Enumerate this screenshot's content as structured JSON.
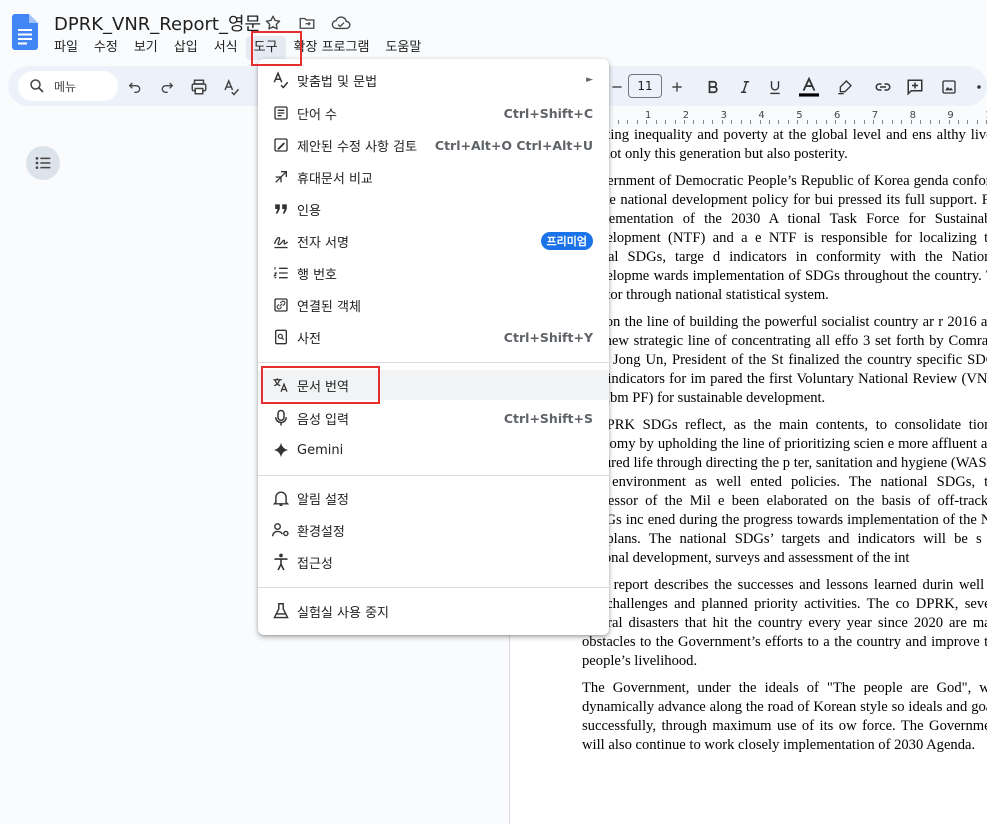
{
  "document": {
    "title": "DPRK_VNR_Report_영문"
  },
  "menubar": {
    "items": [
      "파일",
      "수정",
      "보기",
      "삽입",
      "서식",
      "도구",
      "확장 프로그램",
      "도움말"
    ],
    "active": "도구"
  },
  "toolbar": {
    "search_label": "메뉴",
    "font_size": "11"
  },
  "ruler": {
    "numbers": [
      "1",
      "2",
      "3",
      "4",
      "5",
      "6",
      "7",
      "8",
      "9",
      "10",
      "1"
    ]
  },
  "tools_menu": {
    "items": [
      {
        "label": "맞춤법 및 문법",
        "shortcut": "",
        "icon": "spellcheck-icon",
        "submenu": true
      },
      {
        "label": "단어 수",
        "shortcut": "Ctrl+Shift+C",
        "icon": "word-count-icon"
      },
      {
        "label": "제안된 수정 사항 검토",
        "shortcut": "Ctrl+Alt+O Ctrl+Alt+U",
        "icon": "review-edits-icon"
      },
      {
        "label": "휴대문서 비교",
        "shortcut": "",
        "icon": "compare-icon"
      },
      {
        "label": "인용",
        "shortcut": "",
        "icon": "quote-icon"
      },
      {
        "label": "전자 서명",
        "shortcut": "",
        "icon": "signature-icon",
        "badge": "프리미엄"
      },
      {
        "label": "행 번호",
        "shortcut": "",
        "icon": "line-numbers-icon"
      },
      {
        "label": "연결된 객체",
        "shortcut": "",
        "icon": "linked-objects-icon"
      },
      {
        "label": "사전",
        "shortcut": "Ctrl+Shift+Y",
        "icon": "dictionary-icon"
      },
      {
        "label": "문서 번역",
        "shortcut": "",
        "icon": "translate-icon",
        "highlighted": true
      },
      {
        "label": "음성 입력",
        "shortcut": "Ctrl+Shift+S",
        "icon": "mic-icon"
      },
      {
        "label": "Gemini",
        "shortcut": "",
        "icon": "gemini-icon"
      },
      {
        "label": "알림 설정",
        "shortcut": "",
        "icon": "bell-icon"
      },
      {
        "label": "환경설정",
        "shortcut": "",
        "icon": "preferences-icon"
      },
      {
        "label": "접근성",
        "shortcut": "",
        "icon": "accessibility-icon"
      },
      {
        "label": "실험실 사용 중지",
        "shortcut": "",
        "icon": "labs-icon"
      }
    ]
  },
  "page": {
    "paragraphs": [
      "dicating inequality and poverty at the global level and ens althy lives, for not only this generation but also posterity.",
      "Government of Democratic People’s Republic of Korea genda conform to the national development policy for bui pressed its full support. For implementation of the 2030 A tional Task Force for Sustainable Development (NTF) and a e NTF is responsible for localizing the global SDGs, targe d indicators in conformity with the National Developme wards implementation of SDGs throughout the country. Th dicator through national statistical system.",
      "sed on the line of building the powerful socialist country ar r 2016 and the new strategic line of concentrating all effo 3 set forth by Comrade Kim Jong Un, President of the St finalized the country specific SDGs and indicators for im pared the first Voluntary National Review (VNR) to subm PF) for sustainable development.",
      "e DPRK SDGs reflect, as the main contents, to consolidate tional economy by upholding the line of prioritizing scien e more affluent and cultured life through directing the p ter, sanitation and hygiene (WASH) and environment as well ented policies. The national SDGs, the successor of the Mil e been elaborated on the basis of off-tracked MDGs inc ened during the progress towards implementation of the Nat jor plans. The national SDGs’ targets and indicators will be s of national development, surveys and assessment of the int",
      "This report describes the successes and lessons learned durin well as the challenges and planned priority activities. The co DPRK, severe natural disasters that hit the country every year since 2020 are main obstacles to the Government’s efforts to a the country and improve the people’s livelihood.",
      "The Government, under the ideals of \"The people are God\", will dynamically advance along the road of Korean style so ideals and goals successfully, through maximum use of its ow force. The Government will also continue to work closely implementation of 2030 Agenda."
    ]
  }
}
